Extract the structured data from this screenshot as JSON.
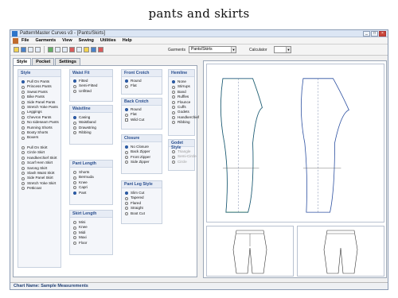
{
  "caption": "pants and skirts",
  "window": {
    "title": "PatternMaster Curves v3 - [Pants/Skirts]"
  },
  "menu": [
    "File",
    "Garments",
    "View",
    "Sewing",
    "Utilities",
    "Help"
  ],
  "toolbar": {
    "garments_label": "Garments",
    "garments_value": "Pants/Skirts",
    "calculator_label": "Calculator"
  },
  "tabs": [
    "Style",
    "Pocket",
    "Settings"
  ],
  "style_group": {
    "title": "Style",
    "items": [
      {
        "label": "Pull On Pants",
        "checked": true
      },
      {
        "label": "Princess Pants",
        "checked": false
      },
      {
        "label": "Sweat Pants",
        "checked": false
      },
      {
        "label": "Bike Pants",
        "checked": false
      },
      {
        "label": "Side Panel Pants",
        "checked": false
      },
      {
        "label": "Stretch Yoke Pants",
        "checked": false
      },
      {
        "label": "Leggings",
        "checked": false
      },
      {
        "label": "Chevron Pants",
        "checked": false
      },
      {
        "label": "No sideseam Pants",
        "checked": false
      },
      {
        "label": "Running Shorts",
        "checked": false
      },
      {
        "label": "Booty Shorts",
        "checked": false
      },
      {
        "label": "Boxers",
        "checked": false
      }
    ],
    "items2": [
      {
        "label": "Pull On Skirt",
        "checked": false
      },
      {
        "label": "Circle Skirt",
        "checked": false
      },
      {
        "label": "Handkerchief Skirt",
        "checked": false
      },
      {
        "label": "Scarf Hem Skirt",
        "checked": false
      },
      {
        "label": "Sarong Skirt",
        "checked": false
      },
      {
        "label": "Slash Waist Skirt",
        "checked": false
      },
      {
        "label": "Side Panel Skirt",
        "checked": false
      },
      {
        "label": "Stretch Yoke Skirt",
        "checked": false
      },
      {
        "label": "Petticoat",
        "checked": false
      }
    ]
  },
  "waist_fit": {
    "title": "Waist Fit",
    "items": [
      {
        "label": "Fitted",
        "checked": true
      },
      {
        "label": "Semi-Fitted",
        "checked": false
      },
      {
        "label": "Unfitted",
        "checked": false
      }
    ]
  },
  "waistline": {
    "title": "Waistline",
    "items": [
      {
        "label": "Casing",
        "checked": true
      },
      {
        "label": "Waistband",
        "checked": false
      },
      {
        "label": "Drawstring",
        "checked": false
      },
      {
        "label": "Ribbing",
        "checked": false
      }
    ]
  },
  "pant_length": {
    "title": "Pant Length",
    "items": [
      {
        "label": "Shorts",
        "checked": false
      },
      {
        "label": "Bermuda",
        "checked": false
      },
      {
        "label": "Knee",
        "checked": false
      },
      {
        "label": "Capri",
        "checked": false
      },
      {
        "label": "Pant",
        "checked": true
      }
    ]
  },
  "skirt_length": {
    "title": "Skirt Length",
    "items": [
      {
        "label": "Mini",
        "checked": false
      },
      {
        "label": "Knee",
        "checked": false
      },
      {
        "label": "Midi",
        "checked": false
      },
      {
        "label": "Maxi",
        "checked": false
      },
      {
        "label": "Floor",
        "checked": false
      }
    ]
  },
  "front_crotch": {
    "title": "Front Crotch",
    "items": [
      {
        "label": "Round",
        "checked": true
      },
      {
        "label": "Flat",
        "checked": false
      }
    ]
  },
  "back_crotch": {
    "title": "Back Crotch",
    "items": [
      {
        "label": "Round",
        "checked": true
      },
      {
        "label": "Flat",
        "checked": false
      }
    ],
    "check": "Wild Cut"
  },
  "closure": {
    "title": "Closure",
    "items": [
      {
        "label": "No Closure",
        "checked": true
      },
      {
        "label": "Back Zipper",
        "checked": false
      },
      {
        "label": "Front Zipper",
        "checked": false
      },
      {
        "label": "Side Zipper",
        "checked": false
      }
    ]
  },
  "pant_leg_style": {
    "title": "Pant Leg Style",
    "items": [
      {
        "label": "Slim Cut",
        "checked": true
      },
      {
        "label": "Tapered",
        "checked": false
      },
      {
        "label": "Flared",
        "checked": false
      },
      {
        "label": "Straight",
        "checked": false
      },
      {
        "label": "Boot Cut",
        "checked": false
      }
    ]
  },
  "hemline": {
    "title": "Hemline",
    "items": [
      {
        "label": "None",
        "checked": true
      },
      {
        "label": "Stirrups",
        "checked": false
      },
      {
        "label": "Band",
        "checked": false
      },
      {
        "label": "Ruffles",
        "checked": false
      },
      {
        "label": "Flounce",
        "checked": false
      },
      {
        "label": "Cuffs",
        "checked": false
      },
      {
        "label": "Godets",
        "checked": false
      },
      {
        "label": "Handkerchief",
        "checked": false
      },
      {
        "label": "Ribbing",
        "checked": false
      }
    ]
  },
  "godet_style": {
    "title": "Godet Style",
    "items": [
      {
        "label": "Triangle",
        "checked": false
      },
      {
        "label": "Semi-Circle",
        "checked": false
      },
      {
        "label": "Circle",
        "checked": false
      }
    ]
  },
  "status": {
    "label": "Chart Name:",
    "value": "Sample Measurements"
  }
}
